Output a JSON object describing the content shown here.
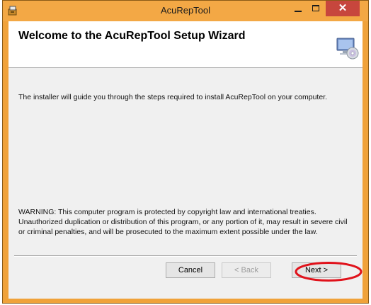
{
  "window": {
    "title": "AcuRepTool",
    "close_symbol": "✕",
    "icons": [
      "app-installer-icon",
      "minimize-icon",
      "maximize-icon",
      "close-icon"
    ]
  },
  "banner": {
    "title": "Welcome to the AcuRepTool Setup Wizard",
    "icon": "computer-disc-icon"
  },
  "content": {
    "intro": "The installer will guide you through the steps required to install AcuRepTool on your computer.",
    "warning": "WARNING: This computer program is protected by copyright law and international treaties. Unauthorized duplication or distribution of this program, or any portion of it, may result in severe civil or criminal penalties, and will be prosecuted to the maximum extent possible under the law."
  },
  "buttons": {
    "cancel": "Cancel",
    "back": "< Back",
    "next": "Next >"
  },
  "colors": {
    "frame": "#f3a845",
    "close": "#c7463d",
    "highlight": "#e0121b"
  }
}
